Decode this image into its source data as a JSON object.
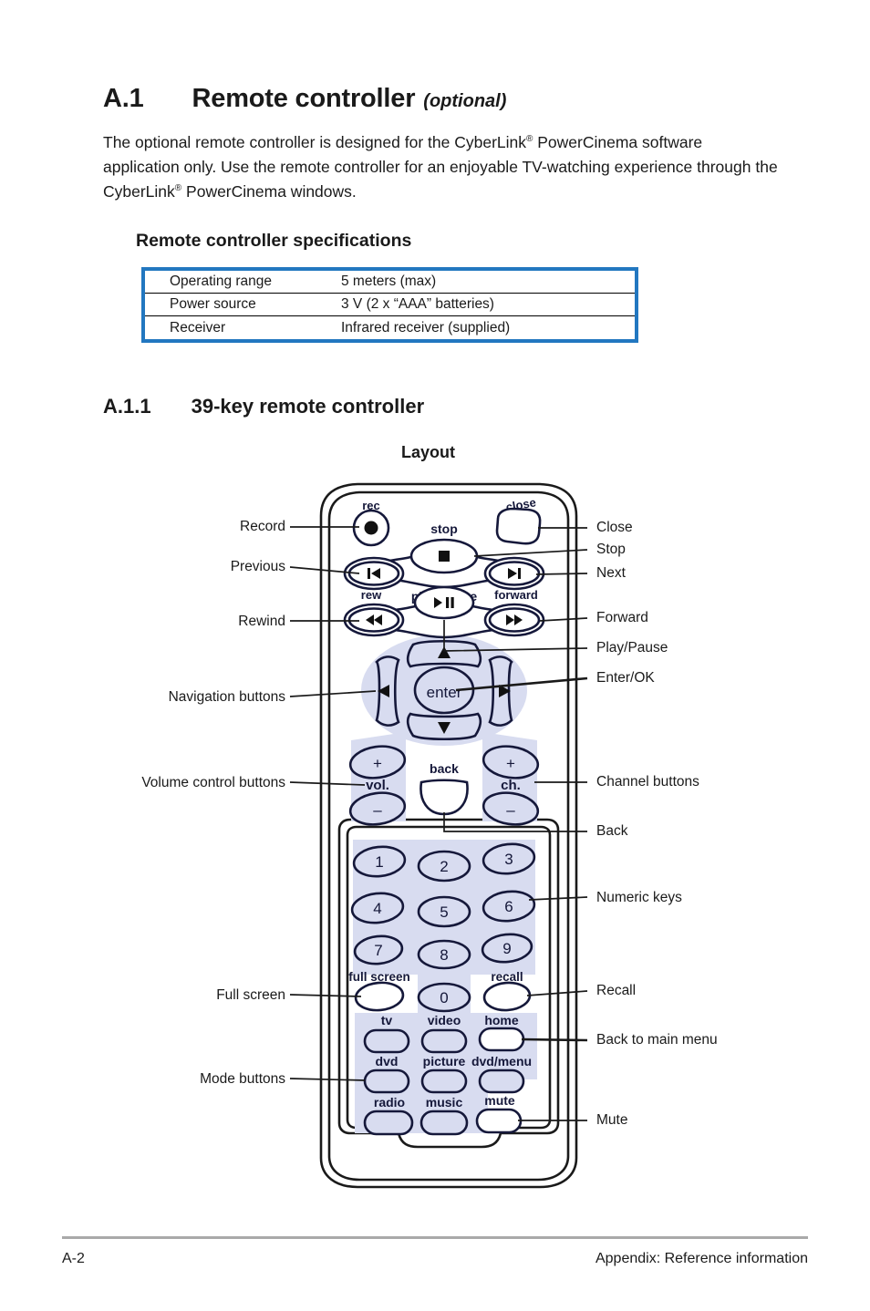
{
  "colors": {
    "accent_blue": "#2277c0",
    "key_fill": "#d8dcf0",
    "ink": "#1a1a1a",
    "footer_rule": "#a9a9a9"
  },
  "heading": {
    "number": "A.1",
    "title": "Remote controller",
    "optional": "(optional)"
  },
  "intro": {
    "line1_a": "The optional remote controller is designed for the CyberLink",
    "line1_sup": "®",
    "line1_b": " PowerCinema",
    "line2": "software application only. Use the remote controller for an enjoyable TV-watching",
    "line3_a": "experience through the CyberLink",
    "line3_sup": "®",
    "line3_b": " PowerCinema windows."
  },
  "spec_section": {
    "title": "Remote controller specifications",
    "rows": [
      {
        "label": "Operating range",
        "value": "5 meters (max)"
      },
      {
        "label": "Power source",
        "value": "3 V (2 x “AAA” batteries)"
      },
      {
        "label": "Receiver",
        "value": "Infrared receiver (supplied)"
      }
    ]
  },
  "subsection": {
    "number": "A.1.1",
    "title": "39-key remote controller",
    "figure_title": "Layout"
  },
  "remote": {
    "key_labels": {
      "rec": "rec",
      "close": "close",
      "stop": "stop",
      "play_pause": "play/pause",
      "rew": "rew",
      "forward": "forward",
      "enter": "enter",
      "vol": "vol.",
      "ch": "ch.",
      "back": "back",
      "full_screen": "full screen",
      "recall": "recall",
      "tv": "tv",
      "video": "video",
      "home": "home",
      "dvd": "dvd",
      "picture": "picture",
      "dvd_menu": "dvd/menu",
      "radio": "radio",
      "music": "music",
      "mute": "mute"
    },
    "numeric_keys": [
      "1",
      "2",
      "3",
      "4",
      "5",
      "6",
      "7",
      "8",
      "9",
      "0"
    ],
    "vol_plus": "+",
    "vol_minus": "−",
    "ch_plus": "+",
    "ch_minus": "−"
  },
  "callouts": {
    "left": [
      {
        "id": "record",
        "label": "Record"
      },
      {
        "id": "previous",
        "label": "Previous"
      },
      {
        "id": "rewind",
        "label": "Rewind"
      },
      {
        "id": "navigation-buttons",
        "label": "Navigation buttons"
      },
      {
        "id": "volume-control-buttons",
        "label": "Volume control buttons"
      },
      {
        "id": "full-screen",
        "label": "Full screen"
      },
      {
        "id": "mode-buttons",
        "label": "Mode buttons"
      }
    ],
    "right": [
      {
        "id": "close",
        "label": "Close"
      },
      {
        "id": "stop",
        "label": "Stop"
      },
      {
        "id": "next",
        "label": "Next"
      },
      {
        "id": "forward",
        "label": "Forward"
      },
      {
        "id": "play-pause",
        "label": "Play/Pause"
      },
      {
        "id": "enter-ok",
        "label": "Enter/OK"
      },
      {
        "id": "channel-buttons",
        "label": "Channel buttons"
      },
      {
        "id": "back",
        "label": "Back"
      },
      {
        "id": "numeric-keys",
        "label": "Numeric keys"
      },
      {
        "id": "recall",
        "label": "Recall"
      },
      {
        "id": "back-to-main-menu",
        "label": "Back to main menu"
      },
      {
        "id": "mute",
        "label": "Mute"
      }
    ]
  },
  "footer": {
    "page": "A-2",
    "section": "Appendix: Reference information"
  }
}
